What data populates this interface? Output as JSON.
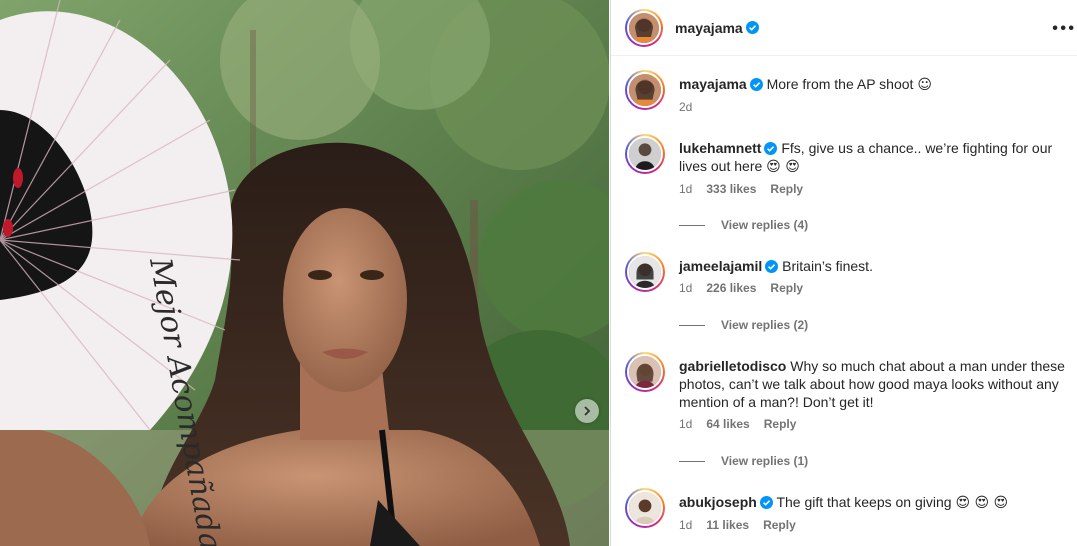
{
  "post": {
    "author": "mayajama",
    "caption": "More from the AP shoot",
    "caption_emoji": "☺",
    "age": "2d"
  },
  "comments": [
    {
      "user": "lukehamnett",
      "text": "Ffs, give us a chance.. we’re fighting for our lives out here",
      "emoji": "😍 😍",
      "age": "1d",
      "likes": "333 likes",
      "reply": "Reply",
      "view_replies": "View replies (4)"
    },
    {
      "user": "jameelajamil",
      "text": "Britain’s finest.",
      "emoji": "",
      "age": "1d",
      "likes": "226 likes",
      "reply": "Reply",
      "view_replies": "View replies (2)"
    },
    {
      "user": "gabrielletodisco",
      "text": "Why so much chat about a man under these photos, can’t we talk about how good maya looks without any mention of a man?! Don’t get it!",
      "emoji": "",
      "age": "1d",
      "likes": "64 likes",
      "reply": "Reply",
      "view_replies": "View replies (1)"
    },
    {
      "user": "abukjoseph",
      "text": "The gift that keeps on giving",
      "emoji": "😍 😍 😍",
      "age": "1d",
      "likes": "11 likes",
      "reply": "Reply"
    }
  ],
  "fan_text": "Mejor Acompañada",
  "icons": {
    "verified": "verified-badge-icon",
    "more": "more-options-icon",
    "next": "chevron-right-icon"
  },
  "colors": {
    "verified_blue": "#0095f6",
    "meta_grey": "#737373"
  }
}
